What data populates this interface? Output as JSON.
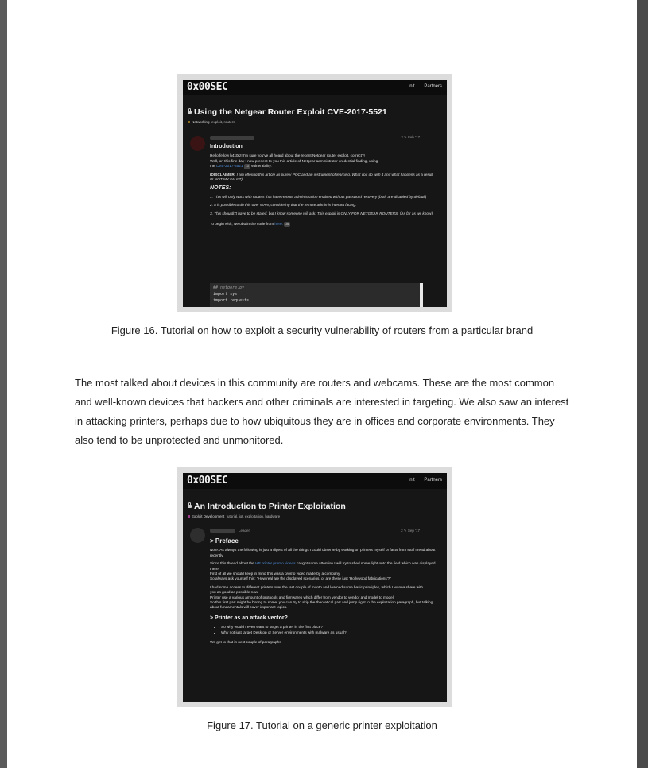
{
  "figure16": {
    "logo": "0x00SEC",
    "nav": [
      "Init",
      "Partners"
    ],
    "title": "Using the Netgear Router Exploit CVE-2017-5521",
    "category": "Networking",
    "tags": "exploit, routers",
    "date": "2 ✎ Feb '17",
    "heading": "Introduction",
    "intro_line1": "Hello fellow h4x0rz! I'm sure you've all heard about the recent Netgear router exploit, correct?!",
    "intro_line2": "Well, on this fine day I now present to you this article of Netgear administrator credential finding, using",
    "intro_line3_a": "the",
    "intro_link": "CVE-2017-5521",
    "intro_badge": "13",
    "intro_line3_b": "vulnerability.",
    "disclaimer_label": "(DISCLAIMER:",
    "disclaimer_text": "I am offering this article as purely POC and an instrument of learning. What you do with it and what happens as a result IS NOT MY FAULT)",
    "notes_heading": "NOTES:",
    "note1": "1. This will only work with routers that have remote administration enabled without password recovery (both are disabled by default)",
    "note2": "2. It is possible to do this over WAN, considering that the remote admin is internet facing.",
    "note3": "3. This shouldn't have to be stated, but I know someone will ask; This exploit is ONLY FOR NETGEAR ROUTERS. (As far as we know)",
    "begin_text": "To begin with, we obtain the code from",
    "begin_link": "here.",
    "begin_badge": "26",
    "code_lines": [
      "## netgore.py",
      "import sys",
      "import requests"
    ]
  },
  "caption16": "Figure 16. Tutorial on how to exploit a security vulnerability of routers from a particular brand",
  "paragraph": "The most talked about devices in this community are routers and webcams. These are the most common and well-known devices that hackers and other criminals are interested in targeting. We also saw an interest in attacking printers, perhaps due to how ubiquitous they are in offices and corporate environments. They also tend to be unprotected and unmonitored.",
  "figure17": {
    "logo": "0x00SEC",
    "nav": [
      "Init",
      "Partners"
    ],
    "title": "An Introduction to Printer Exploitation",
    "category": "Exploit Development",
    "tags": "tutorial, iot, exploitation, hardware",
    "role": "Leader",
    "date": "2 ✎ Sep '17",
    "heading": "> Preface",
    "note_label": "Note:",
    "note_text": "As always the following is just a digest of all the things I could observe by working on printers myself or facts from stuff I read about recently.",
    "since_a": "Since this thread about the",
    "since_link": "HP printer promo videos",
    "since_b": "caught some attention I will try to shed some light onto the field which was displayed there.",
    "first_a": "First of all we should keep in mind this was a",
    "first_em": "promo video",
    "first_b": "made by a company.",
    "ask": "So always ask yourself this: \"How real are the displayed scenarios, or are these just 'Hollywood fabrications'?\"",
    "p3_1": "I had some access to different printers over the last couple of month and learned some basic principles, which I wanna share with",
    "p3_2": "you as good as possible now.",
    "p3_3": "Printer use a various amount of protocols and firmwares which differ from vendor to vendor and model to model.",
    "p3_4": "So this first part might be boring to some, you can try to skip the theoretical part and jump right to the exploitation paragraph, but talking about fundamentals will cover important topics.",
    "subheading": "> Printer as an attack vector?",
    "bullets": [
      "So why would I even want to target a printer in the first place?",
      "Why not just target Desktop or Server environments with malware as usual?"
    ],
    "closing": "We get to that in next couple of paragraphs"
  },
  "caption17": "Figure 17. Tutorial on a generic printer exploitation"
}
